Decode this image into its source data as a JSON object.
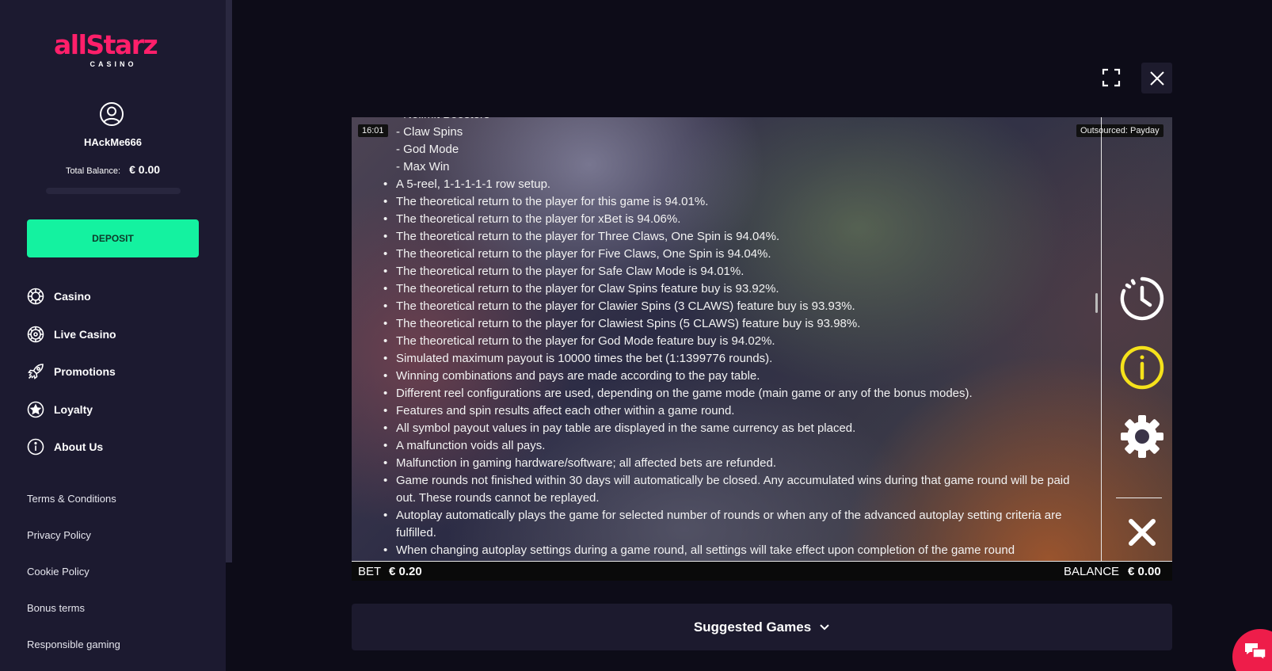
{
  "brand": {
    "name": "allStarz",
    "subtitle": "CASINO",
    "color": "#ff1f6a"
  },
  "user": {
    "name": "HAckMe666",
    "balance_label": "Total Balance:",
    "balance": "€ 0.00"
  },
  "deposit_label": "DEPOSIT",
  "nav": [
    {
      "label": "Casino",
      "icon": "chip-icon"
    },
    {
      "label": "Live Casino",
      "icon": "roulette-icon"
    },
    {
      "label": "Promotions",
      "icon": "rocket-icon"
    },
    {
      "label": "Loyalty",
      "icon": "star-icon"
    },
    {
      "label": "About Us",
      "icon": "info-icon"
    }
  ],
  "links": [
    "Terms & Conditions",
    "Privacy Policy",
    "Cookie Policy",
    "Bonus terms",
    "Responsible gaming"
  ],
  "game": {
    "time": "16:01",
    "outsourced": "Outsourced: Payday",
    "bet_label": "BET",
    "bet_value": "€ 0.20",
    "balance_label": "BALANCE",
    "balance_value": "€ 0.00",
    "sub_items": [
      "- Nolimit Boosters",
      "- Claw Spins",
      "- God Mode",
      "- Max Win"
    ],
    "bullets": [
      "A 5-reel, 1-1-1-1-1 row setup.",
      "The theoretical return to the player for this game is 94.01%.",
      "The theoretical return to the player for xBet is 94.06%.",
      "The theoretical return to the player for Three Claws, One Spin is 94.04%.",
      "The theoretical return to the player for Five Claws, One Spin is 94.04%.",
      "The theoretical return to the player for Safe Claw Mode is 94.01%.",
      "The theoretical return to the player for Claw Spins feature buy is 93.92%.",
      "The theoretical return to the player for Clawier Spins (3 CLAWS) feature buy is 93.93%.",
      "The theoretical return to the player for Clawiest Spins (5 CLAWS) feature buy is 93.98%.",
      "The theoretical return to the player for God Mode feature buy is 94.02%.",
      "Simulated maximum payout is 10000 times the bet (1:1399776 rounds).",
      "Winning combinations and pays are made according to the pay table.",
      "Different reel configurations are used, depending on the game mode (main game or any of the bonus modes).",
      "Features and spin results affect each other within a game round.",
      "All symbol payout values in pay table are displayed in the same currency as bet placed.",
      "A malfunction voids all pays.",
      "Malfunction in gaming hardware/software; all affected bets are refunded.",
      "Game rounds not finished within 30 days will automatically be closed. Any accumulated wins during that game round will be paid out. These rounds cannot be replayed.",
      "Autoplay automatically plays the game for selected number of rounds or when any of the advanced autoplay setting criteria are fulfilled.",
      "When changing autoplay settings during a game round, all settings will take effect upon completion of the game round"
    ],
    "info_accent": "#f5e21b"
  },
  "suggested_label": "Suggested Games",
  "chat_color": "#ee1d4a",
  "deposit_color": "#14f2a0"
}
